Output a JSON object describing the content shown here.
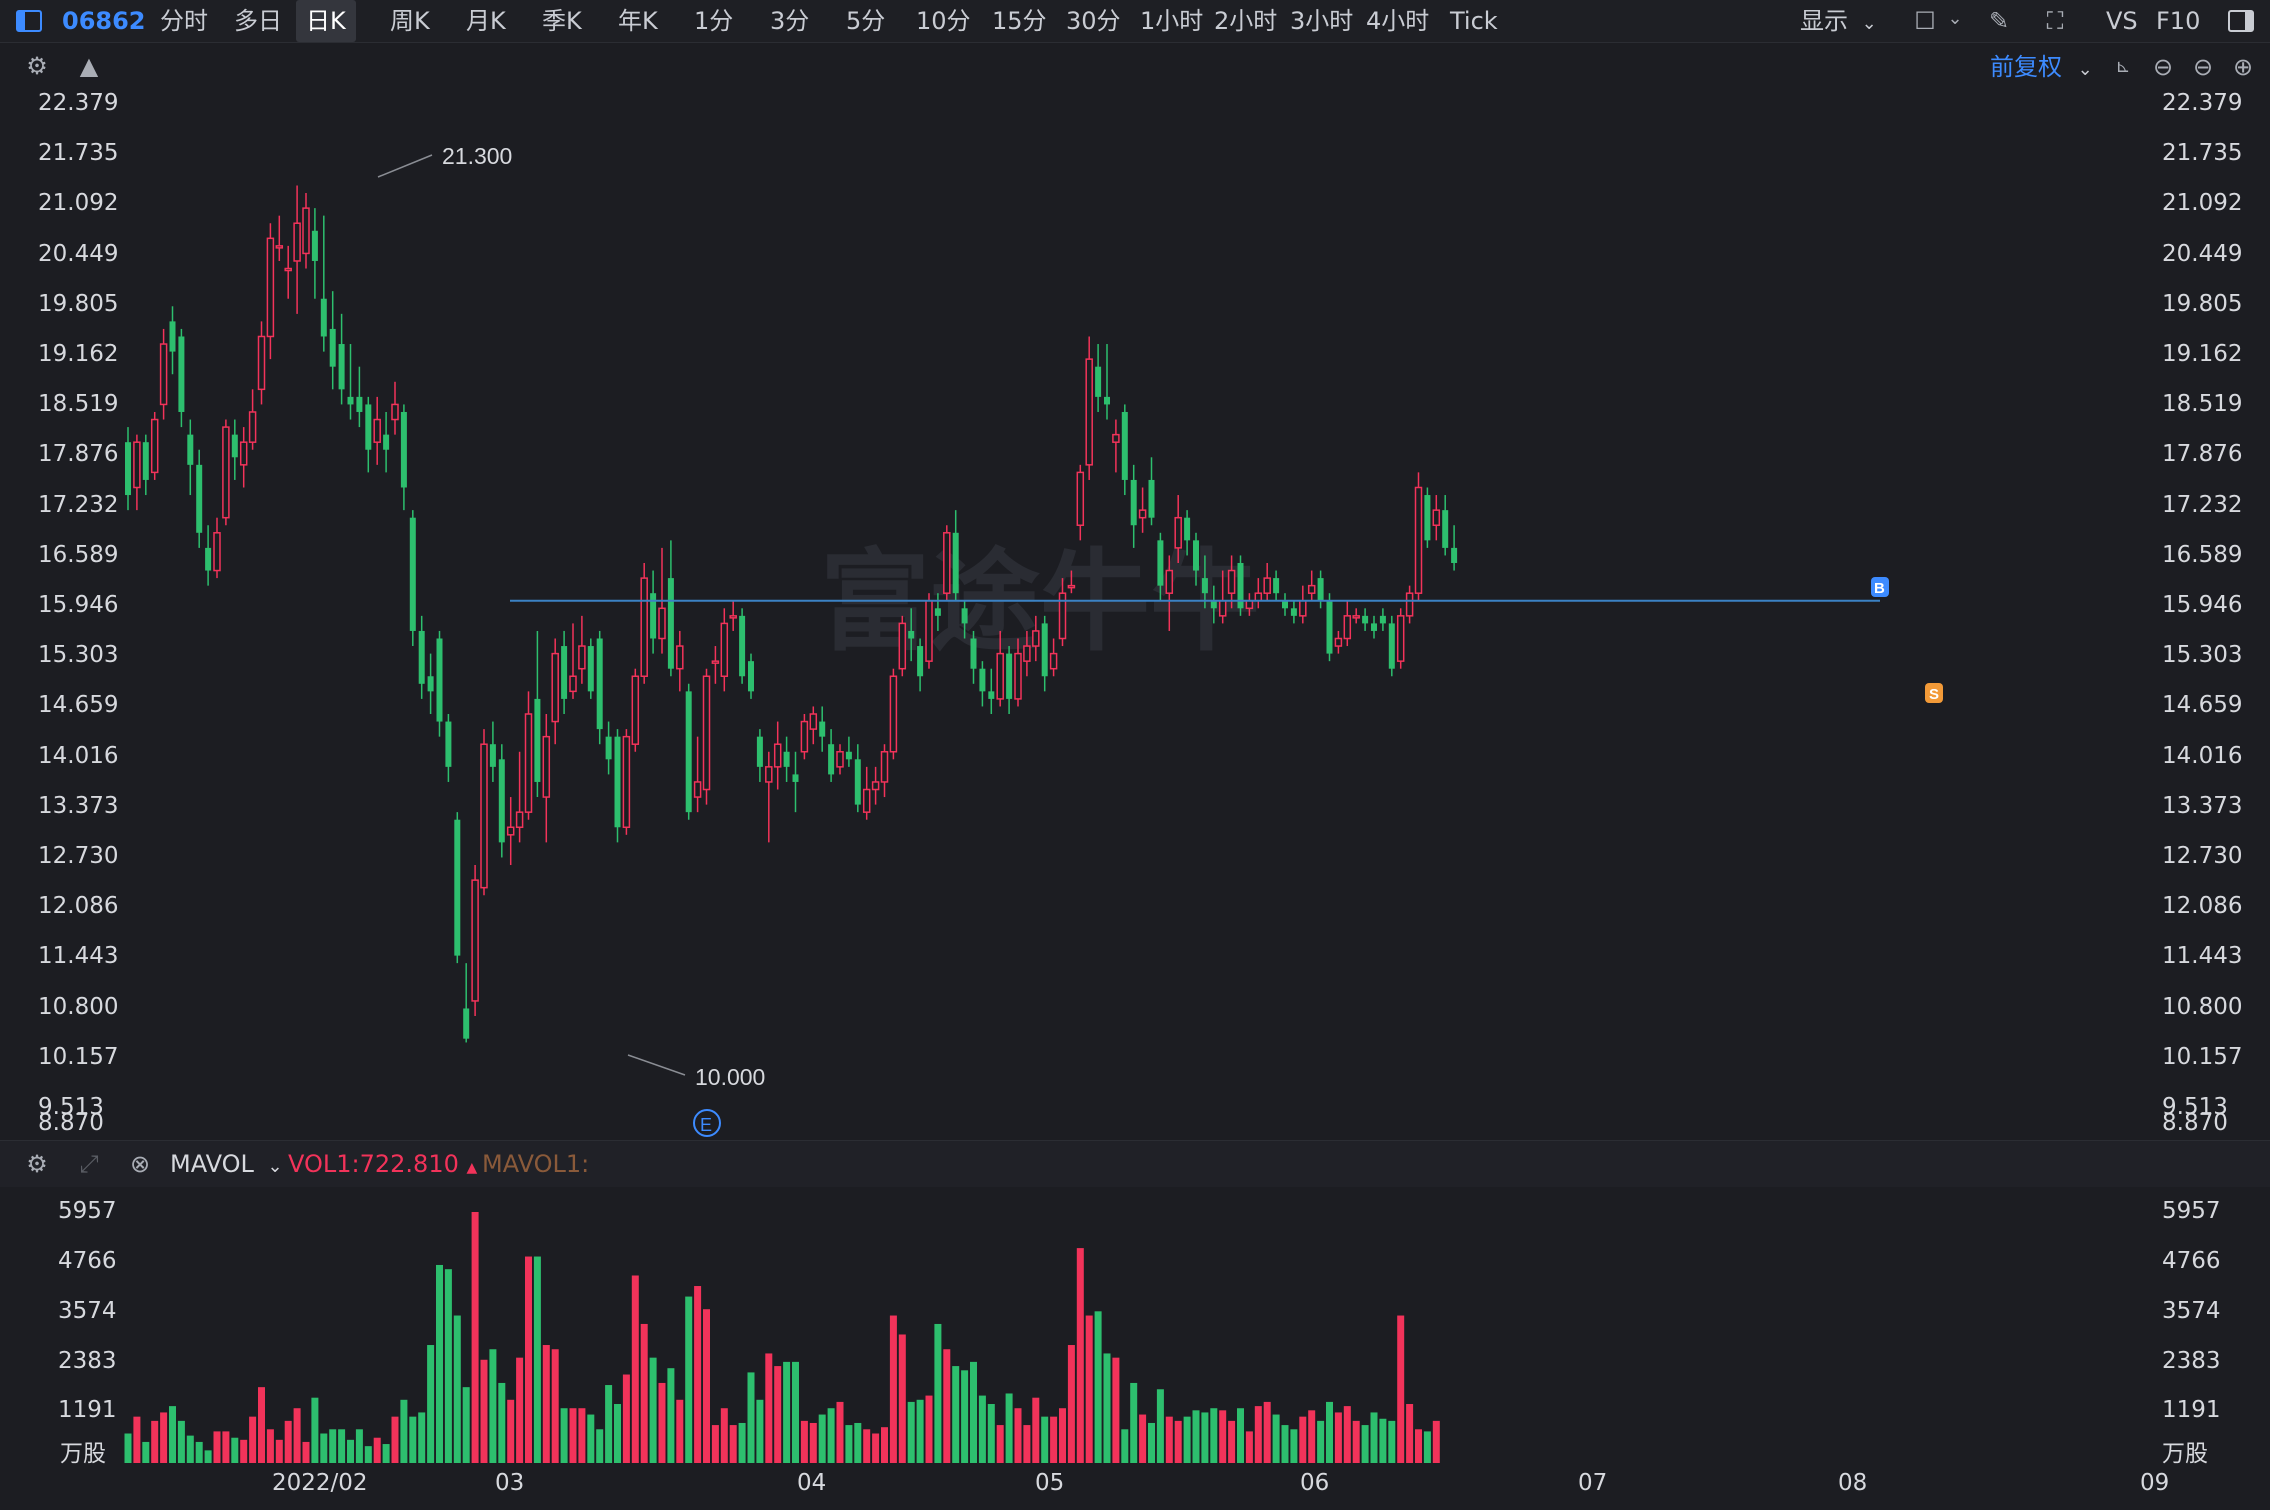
{
  "toolbar": {
    "code": "06862",
    "periods": [
      "分时",
      "多日",
      "日K",
      "周K",
      "月K",
      "季K",
      "年K",
      "1分",
      "3分",
      "5分",
      "10分",
      "15分",
      "30分",
      "1小时",
      "2小时",
      "3小时",
      "4小时",
      "Tick"
    ],
    "active_period": "日K",
    "display_label": "显示",
    "vs_label": "VS",
    "f10_label": "F10",
    "adjust_label": "前复权"
  },
  "price_axis": {
    "ticks": [
      "22.379",
      "21.735",
      "21.092",
      "20.449",
      "19.805",
      "19.162",
      "18.519",
      "17.876",
      "17.232",
      "16.589",
      "15.946",
      "15.303",
      "14.659",
      "14.016",
      "13.373",
      "12.730",
      "12.086",
      "11.443",
      "10.800",
      "10.157",
      "9.513",
      "8.870"
    ],
    "high_label": "21.300",
    "low_label": "10.000"
  },
  "volume_panel": {
    "indicator": "MAVOL",
    "vol1_label": "VOL1:722.810",
    "mavol1_label": "MAVOL1:",
    "ticks": [
      "5957",
      "4766",
      "3574",
      "2383",
      "1191"
    ],
    "unit": "万股"
  },
  "x_axis": {
    "labels": [
      "2022/02",
      "03",
      "04",
      "05",
      "06",
      "07",
      "08",
      "09"
    ]
  },
  "markers": {
    "earnings": "E",
    "buy": "B",
    "sell": "S"
  },
  "watermark": "富途牛牛",
  "colors": {
    "up": "#f2335a",
    "down": "#2dbf6e",
    "accent": "#3d8bff",
    "hline": "#3b82c4"
  },
  "chart_data": {
    "type": "candlestick",
    "ylim": [
      8.87,
      22.379
    ],
    "x_axis_labels": [
      "2022/02",
      "03",
      "04",
      "05",
      "06",
      "07",
      "08",
      "09"
    ],
    "candles": [
      {
        "o": 17.9,
        "c": 17.2,
        "h": 18.1,
        "l": 17.0
      },
      {
        "o": 17.3,
        "c": 17.9,
        "h": 18.0,
        "l": 17.0
      },
      {
        "o": 17.9,
        "c": 17.4,
        "h": 18.0,
        "l": 17.2
      },
      {
        "o": 17.5,
        "c": 18.2,
        "h": 18.3,
        "l": 17.4
      },
      {
        "o": 18.4,
        "c": 19.2,
        "h": 19.4,
        "l": 18.2
      },
      {
        "o": 19.5,
        "c": 19.1,
        "h": 19.7,
        "l": 18.8
      },
      {
        "o": 19.3,
        "c": 18.3,
        "h": 19.4,
        "l": 18.1
      },
      {
        "o": 18.0,
        "c": 17.6,
        "h": 18.2,
        "l": 17.2
      },
      {
        "o": 17.6,
        "c": 16.7,
        "h": 17.8,
        "l": 16.5
      },
      {
        "o": 16.5,
        "c": 16.2,
        "h": 16.8,
        "l": 16.0
      },
      {
        "o": 16.2,
        "c": 16.7,
        "h": 16.9,
        "l": 16.1
      },
      {
        "o": 16.9,
        "c": 18.1,
        "h": 18.2,
        "l": 16.8
      },
      {
        "o": 18.0,
        "c": 17.7,
        "h": 18.2,
        "l": 17.4
      },
      {
        "o": 17.6,
        "c": 17.9,
        "h": 18.1,
        "l": 17.3
      },
      {
        "o": 17.9,
        "c": 18.3,
        "h": 18.6,
        "l": 17.8
      },
      {
        "o": 18.6,
        "c": 19.3,
        "h": 19.5,
        "l": 18.4
      },
      {
        "o": 19.3,
        "c": 20.6,
        "h": 20.8,
        "l": 19.0
      },
      {
        "o": 20.5,
        "c": 20.5,
        "h": 20.9,
        "l": 20.3
      },
      {
        "o": 20.2,
        "c": 20.2,
        "h": 20.5,
        "l": 19.8
      },
      {
        "o": 20.3,
        "c": 20.8,
        "h": 21.3,
        "l": 19.6
      },
      {
        "o": 20.4,
        "c": 21.0,
        "h": 21.2,
        "l": 20.2
      },
      {
        "o": 20.7,
        "c": 20.3,
        "h": 21.0,
        "l": 19.8
      },
      {
        "o": 19.8,
        "c": 19.3,
        "h": 20.9,
        "l": 19.1
      },
      {
        "o": 19.4,
        "c": 18.9,
        "h": 19.9,
        "l": 18.6
      },
      {
        "o": 19.2,
        "c": 18.6,
        "h": 19.6,
        "l": 18.4
      },
      {
        "o": 18.5,
        "c": 18.4,
        "h": 19.2,
        "l": 18.2
      },
      {
        "o": 18.5,
        "c": 18.3,
        "h": 18.9,
        "l": 18.1
      },
      {
        "o": 18.4,
        "c": 17.8,
        "h": 18.5,
        "l": 17.5
      },
      {
        "o": 17.9,
        "c": 18.2,
        "h": 18.5,
        "l": 17.6
      },
      {
        "o": 18.0,
        "c": 17.8,
        "h": 18.3,
        "l": 17.5
      },
      {
        "o": 18.2,
        "c": 18.4,
        "h": 18.7,
        "l": 18.0
      },
      {
        "o": 18.3,
        "c": 17.3,
        "h": 18.4,
        "l": 17.0
      },
      {
        "o": 16.9,
        "c": 15.4,
        "h": 17.0,
        "l": 15.2
      },
      {
        "o": 15.4,
        "c": 14.7,
        "h": 15.6,
        "l": 14.5
      },
      {
        "o": 14.8,
        "c": 14.6,
        "h": 15.1,
        "l": 14.3
      },
      {
        "o": 15.3,
        "c": 14.2,
        "h": 15.4,
        "l": 14.0
      },
      {
        "o": 14.2,
        "c": 13.6,
        "h": 14.3,
        "l": 13.4
      },
      {
        "o": 12.9,
        "c": 11.1,
        "h": 13.0,
        "l": 11.0
      },
      {
        "o": 10.4,
        "c": 10.0,
        "h": 11.0,
        "l": 9.95
      },
      {
        "o": 10.5,
        "c": 12.1,
        "h": 12.3,
        "l": 10.3
      },
      {
        "o": 12.0,
        "c": 13.9,
        "h": 14.1,
        "l": 11.9
      },
      {
        "o": 13.9,
        "c": 13.6,
        "h": 14.2,
        "l": 13.4
      },
      {
        "o": 13.7,
        "c": 12.6,
        "h": 13.9,
        "l": 12.4
      },
      {
        "o": 12.7,
        "c": 12.8,
        "h": 13.2,
        "l": 12.3
      },
      {
        "o": 12.8,
        "c": 13.0,
        "h": 13.8,
        "l": 12.6
      },
      {
        "o": 13.0,
        "c": 14.3,
        "h": 14.6,
        "l": 12.9
      },
      {
        "o": 14.5,
        "c": 13.4,
        "h": 15.4,
        "l": 13.2
      },
      {
        "o": 13.2,
        "c": 14.0,
        "h": 14.3,
        "l": 12.6
      },
      {
        "o": 14.2,
        "c": 15.1,
        "h": 15.3,
        "l": 13.9
      },
      {
        "o": 15.2,
        "c": 14.5,
        "h": 15.4,
        "l": 14.3
      },
      {
        "o": 14.6,
        "c": 14.8,
        "h": 15.5,
        "l": 14.5
      },
      {
        "o": 14.9,
        "c": 15.2,
        "h": 15.6,
        "l": 14.7
      },
      {
        "o": 15.2,
        "c": 14.6,
        "h": 15.3,
        "l": 14.5
      },
      {
        "o": 15.3,
        "c": 14.1,
        "h": 15.4,
        "l": 13.9
      },
      {
        "o": 14.0,
        "c": 13.7,
        "h": 14.2,
        "l": 13.5
      },
      {
        "o": 14.0,
        "c": 12.8,
        "h": 14.1,
        "l": 12.6
      },
      {
        "o": 12.8,
        "c": 14.0,
        "h": 14.1,
        "l": 12.7
      },
      {
        "o": 13.9,
        "c": 14.8,
        "h": 14.9,
        "l": 13.8
      },
      {
        "o": 14.8,
        "c": 16.1,
        "h": 16.3,
        "l": 14.7
      },
      {
        "o": 15.9,
        "c": 15.3,
        "h": 16.2,
        "l": 15.1
      },
      {
        "o": 15.3,
        "c": 15.7,
        "h": 16.5,
        "l": 15.1
      },
      {
        "o": 16.1,
        "c": 14.9,
        "h": 16.6,
        "l": 14.8
      },
      {
        "o": 14.9,
        "c": 15.2,
        "h": 15.4,
        "l": 14.6
      },
      {
        "o": 14.6,
        "c": 13.0,
        "h": 14.7,
        "l": 12.9
      },
      {
        "o": 13.2,
        "c": 13.4,
        "h": 14.0,
        "l": 13.0
      },
      {
        "o": 13.3,
        "c": 14.8,
        "h": 14.9,
        "l": 13.1
      },
      {
        "o": 15.0,
        "c": 15.0,
        "h": 15.2,
        "l": 14.7
      },
      {
        "o": 14.8,
        "c": 15.5,
        "h": 15.7,
        "l": 14.6
      },
      {
        "o": 15.6,
        "c": 15.6,
        "h": 15.8,
        "l": 15.4
      },
      {
        "o": 15.6,
        "c": 14.8,
        "h": 15.7,
        "l": 14.7
      },
      {
        "o": 15.0,
        "c": 14.6,
        "h": 15.1,
        "l": 14.5
      },
      {
        "o": 14.0,
        "c": 13.6,
        "h": 14.1,
        "l": 13.4
      },
      {
        "o": 13.4,
        "c": 13.6,
        "h": 13.8,
        "l": 12.6
      },
      {
        "o": 13.6,
        "c": 13.9,
        "h": 14.2,
        "l": 13.3
      },
      {
        "o": 13.8,
        "c": 13.6,
        "h": 14.0,
        "l": 13.4
      },
      {
        "o": 13.5,
        "c": 13.4,
        "h": 13.8,
        "l": 13.0
      },
      {
        "o": 13.8,
        "c": 14.2,
        "h": 14.3,
        "l": 13.7
      },
      {
        "o": 14.1,
        "c": 14.3,
        "h": 14.4,
        "l": 13.9
      },
      {
        "o": 14.2,
        "c": 14.0,
        "h": 14.4,
        "l": 13.8
      },
      {
        "o": 13.9,
        "c": 13.5,
        "h": 14.1,
        "l": 13.4
      },
      {
        "o": 13.6,
        "c": 13.8,
        "h": 13.9,
        "l": 13.5
      },
      {
        "o": 13.8,
        "c": 13.7,
        "h": 14.0,
        "l": 13.6
      },
      {
        "o": 13.7,
        "c": 13.1,
        "h": 13.9,
        "l": 13.0
      },
      {
        "o": 13.0,
        "c": 13.3,
        "h": 13.6,
        "l": 12.9
      },
      {
        "o": 13.3,
        "c": 13.4,
        "h": 13.6,
        "l": 13.1
      },
      {
        "o": 13.4,
        "c": 13.8,
        "h": 13.9,
        "l": 13.2
      },
      {
        "o": 13.8,
        "c": 14.8,
        "h": 14.9,
        "l": 13.7
      },
      {
        "o": 14.9,
        "c": 15.5,
        "h": 15.6,
        "l": 14.8
      },
      {
        "o": 15.4,
        "c": 15.3,
        "h": 15.7,
        "l": 15.0
      },
      {
        "o": 15.2,
        "c": 14.8,
        "h": 15.3,
        "l": 14.6
      },
      {
        "o": 15.0,
        "c": 15.8,
        "h": 15.9,
        "l": 14.9
      },
      {
        "o": 15.7,
        "c": 15.6,
        "h": 15.9,
        "l": 15.4
      },
      {
        "o": 15.9,
        "c": 16.7,
        "h": 16.8,
        "l": 15.8
      },
      {
        "o": 16.7,
        "c": 15.9,
        "h": 17.0,
        "l": 15.8
      },
      {
        "o": 15.7,
        "c": 15.5,
        "h": 15.8,
        "l": 15.3
      },
      {
        "o": 15.3,
        "c": 14.9,
        "h": 15.4,
        "l": 14.7
      },
      {
        "o": 14.9,
        "c": 14.6,
        "h": 15.0,
        "l": 14.4
      },
      {
        "o": 14.6,
        "c": 14.5,
        "h": 14.9,
        "l": 14.3
      },
      {
        "o": 14.5,
        "c": 15.1,
        "h": 15.4,
        "l": 14.4
      },
      {
        "o": 15.1,
        "c": 14.5,
        "h": 15.2,
        "l": 14.3
      },
      {
        "o": 14.5,
        "c": 15.1,
        "h": 15.3,
        "l": 14.4
      },
      {
        "o": 15.0,
        "c": 15.2,
        "h": 15.4,
        "l": 14.8
      },
      {
        "o": 15.2,
        "c": 15.4,
        "h": 15.6,
        "l": 15.0
      },
      {
        "o": 15.5,
        "c": 14.8,
        "h": 15.6,
        "l": 14.6
      },
      {
        "o": 14.9,
        "c": 15.1,
        "h": 15.3,
        "l": 14.8
      },
      {
        "o": 15.3,
        "c": 15.9,
        "h": 16.1,
        "l": 15.2
      },
      {
        "o": 16.0,
        "c": 16.0,
        "h": 16.2,
        "l": 15.9
      },
      {
        "o": 16.8,
        "c": 17.5,
        "h": 17.6,
        "l": 16.6
      },
      {
        "o": 17.6,
        "c": 19.0,
        "h": 19.3,
        "l": 17.4
      },
      {
        "o": 18.9,
        "c": 18.5,
        "h": 19.2,
        "l": 18.3
      },
      {
        "o": 18.5,
        "c": 18.4,
        "h": 19.2,
        "l": 18.2
      },
      {
        "o": 17.9,
        "c": 18.0,
        "h": 18.2,
        "l": 17.5
      },
      {
        "o": 18.3,
        "c": 17.4,
        "h": 18.4,
        "l": 17.2
      },
      {
        "o": 17.4,
        "c": 16.8,
        "h": 17.6,
        "l": 16.5
      },
      {
        "o": 16.9,
        "c": 17.0,
        "h": 17.3,
        "l": 16.7
      },
      {
        "o": 17.4,
        "c": 16.9,
        "h": 17.7,
        "l": 16.8
      },
      {
        "o": 16.6,
        "c": 16.0,
        "h": 16.7,
        "l": 15.8
      },
      {
        "o": 15.9,
        "c": 16.2,
        "h": 16.4,
        "l": 15.4
      },
      {
        "o": 16.5,
        "c": 16.9,
        "h": 17.2,
        "l": 16.3
      },
      {
        "o": 16.9,
        "c": 16.6,
        "h": 17.0,
        "l": 16.4
      },
      {
        "o": 16.6,
        "c": 16.2,
        "h": 16.7,
        "l": 16.0
      },
      {
        "o": 16.1,
        "c": 15.9,
        "h": 16.4,
        "l": 15.7
      },
      {
        "o": 15.8,
        "c": 15.7,
        "h": 16.0,
        "l": 15.5
      },
      {
        "o": 15.6,
        "c": 15.8,
        "h": 16.2,
        "l": 15.5
      },
      {
        "o": 15.9,
        "c": 16.2,
        "h": 16.4,
        "l": 15.7
      },
      {
        "o": 16.3,
        "c": 15.7,
        "h": 16.4,
        "l": 15.6
      },
      {
        "o": 15.7,
        "c": 15.8,
        "h": 15.9,
        "l": 15.6
      },
      {
        "o": 15.8,
        "c": 15.9,
        "h": 16.1,
        "l": 15.7
      },
      {
        "o": 15.9,
        "c": 16.1,
        "h": 16.3,
        "l": 15.8
      },
      {
        "o": 16.1,
        "c": 15.9,
        "h": 16.2,
        "l": 15.8
      },
      {
        "o": 15.8,
        "c": 15.7,
        "h": 15.9,
        "l": 15.6
      },
      {
        "o": 15.7,
        "c": 15.6,
        "h": 15.8,
        "l": 15.5
      },
      {
        "o": 15.6,
        "c": 15.8,
        "h": 16.0,
        "l": 15.5
      },
      {
        "o": 15.9,
        "c": 16.0,
        "h": 16.2,
        "l": 15.8
      },
      {
        "o": 16.1,
        "c": 15.8,
        "h": 16.2,
        "l": 15.7
      },
      {
        "o": 15.8,
        "c": 15.1,
        "h": 15.9,
        "l": 15.0
      },
      {
        "o": 15.2,
        "c": 15.3,
        "h": 15.4,
        "l": 15.1
      },
      {
        "o": 15.3,
        "c": 15.6,
        "h": 15.8,
        "l": 15.2
      },
      {
        "o": 15.6,
        "c": 15.6,
        "h": 15.7,
        "l": 15.5
      },
      {
        "o": 15.6,
        "c": 15.5,
        "h": 15.7,
        "l": 15.4
      },
      {
        "o": 15.5,
        "c": 15.4,
        "h": 15.6,
        "l": 15.3
      },
      {
        "o": 15.6,
        "c": 15.5,
        "h": 15.7,
        "l": 15.4
      },
      {
        "o": 15.5,
        "c": 14.9,
        "h": 15.6,
        "l": 14.8
      },
      {
        "o": 15.0,
        "c": 15.6,
        "h": 15.7,
        "l": 14.9
      },
      {
        "o": 15.6,
        "c": 15.9,
        "h": 16.0,
        "l": 15.5
      },
      {
        "o": 15.9,
        "c": 17.3,
        "h": 17.5,
        "l": 15.8
      },
      {
        "o": 17.2,
        "c": 16.6,
        "h": 17.3,
        "l": 16.5
      },
      {
        "o": 16.8,
        "c": 17.0,
        "h": 17.2,
        "l": 16.6
      },
      {
        "o": 17.0,
        "c": 16.5,
        "h": 17.2,
        "l": 16.4
      },
      {
        "o": 16.5,
        "c": 16.3,
        "h": 16.8,
        "l": 16.2
      }
    ],
    "volume_ylim": [
      0,
      5957
    ],
    "volumes": [
      700,
      1100,
      500,
      1000,
      1200,
      1350,
      1000,
      650,
      500,
      300,
      750,
      750,
      600,
      550,
      1100,
      1800,
      800,
      550,
      1000,
      1300,
      500,
      1550,
      700,
      800,
      800,
      550,
      800,
      400,
      600,
      450,
      1100,
      1500,
      1100,
      1200,
      2800,
      4700,
      4600,
      3500,
      1800,
      5957,
      2450,
      2700,
      1900,
      1500,
      2500,
      4900,
      4900,
      2800,
      2700,
      1300,
      1300,
      1300,
      1150,
      800,
      1850,
      1400,
      2100,
      4450,
      3300,
      2500,
      1900,
      2250,
      1500,
      3950,
      4200,
      3650,
      900,
      1300,
      900,
      950,
      2150,
      1500,
      2600,
      2300,
      2400,
      2400,
      1000,
      950,
      1150,
      1300,
      1450,
      900,
      950,
      800,
      700,
      850,
      3500,
      3050,
      1450,
      1500,
      1600,
      3300,
      2700,
      2300,
      2200,
      2400,
      1600,
      1400,
      900,
      1650,
      1300,
      900,
      1550,
      1100,
      1100,
      1300,
      2800,
      5100,
      3500,
      3600,
      2600,
      2500,
      800,
      1900,
      1150,
      950,
      1750,
      1100,
      1000,
      1100,
      1250,
      1200,
      1300,
      1250,
      1000,
      1300,
      750,
      1350,
      1450,
      1150,
      900,
      800,
      1100,
      1250,
      1000,
      1450,
      1200,
      1350,
      1000,
      900,
      1200,
      1050,
      1000,
      3500,
      1400,
      800,
      750,
      1000
    ],
    "price_line": 15.8
  }
}
